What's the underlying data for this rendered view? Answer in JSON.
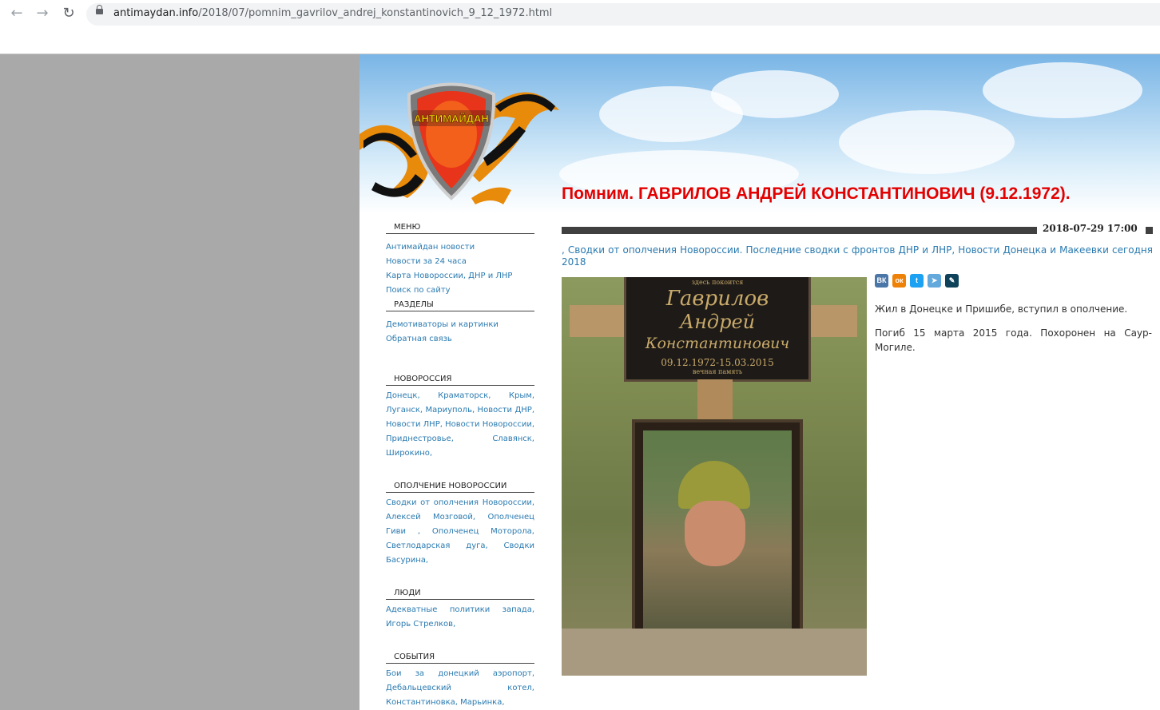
{
  "browser": {
    "url_domain": "antimaydan.info",
    "url_path": "/2018/07/pomnim_gavrilov_andrej_konstantinovich_9_12_1972.html"
  },
  "site": {
    "logo_text": "АНТИМАЙДАН"
  },
  "article": {
    "title": "Помним. ГАВРИЛОВ АНДРЕЙ КОНСТАНТИНОВИЧ (9.12.1972).",
    "date": "2018-07-29 17:00",
    "tags_prefix": ", ",
    "tags": [
      "Сводки от ополчения Новороссии. Последние сводки с фронтов ДНР и ЛНР",
      "Новости Донецка и Макеевки сегодня 2018"
    ],
    "paragraphs": [
      "Жил в Донецке и Пришибе, вступил в ополчение.",
      "Погиб 15 марта 2015 года. Похоронен на Саур-Могиле."
    ],
    "photo": {
      "plaque_small": "здесь покоится",
      "plaque_line1": "Гаврилов",
      "plaque_line2": "Андрей",
      "plaque_line3": "Константинович",
      "plaque_dates": "09.12.1972-15.03.2015",
      "plaque_memory": "вечная память"
    }
  },
  "share": {
    "vk": "ВК",
    "ok": "ок",
    "twitter": "t",
    "telegram": "➤",
    "livejournal": "✎"
  },
  "sidebar": {
    "menu_title": "МЕНЮ",
    "menu_items": [
      "Антимайдан новости",
      "Новости за 24 часа",
      "Карта Новороссии, ДНР и ЛНР",
      "Поиск по сайту"
    ],
    "sections_title": "РАЗДЕЛЫ",
    "sections_items": [
      "Демотиваторы и картинки",
      "Обратная связь"
    ],
    "novorossia_title": "НОВОРОССИЯ",
    "novorossia_text": "Донецк, Краматорск, Крым, Луганск, Мариуполь, Новости ДНР, Новости ЛНР, Новости Новороссии, Приднестровье, Славянск, Широкино,",
    "militia_title": "ОПОЛЧЕНИЕ НОВОРОССИИ",
    "militia_text": "Сводки от ополчения Новороссии, Алексей Мозговой, Ополченец Гиви , Ополченец Моторола, Светлодарская дуга, Сводки Басурина,",
    "people_title": "ЛЮДИ",
    "people_text": "Адекватные политики запада, Игорь Стрелков,",
    "events_title": "СОБЫТИЯ",
    "events_text": "Бои за донецкий аэропорт, Дебальцевский котел, Константиновка, Марьинка,"
  },
  "colors": {
    "title_red": "#e30000",
    "link_blue": "#2a7ab0",
    "left_gray": "#a9a9a9"
  }
}
